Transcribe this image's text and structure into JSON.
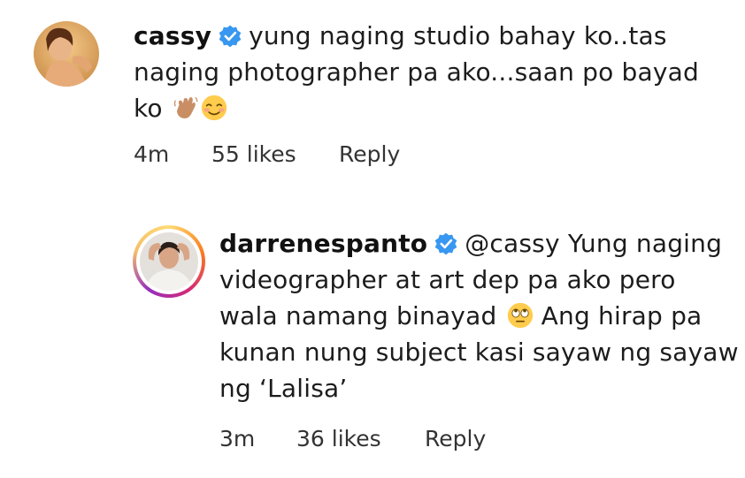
{
  "comments": [
    {
      "username": "cassy",
      "text": "yung naging studio bahay ko..tas naging photographer pa ako...saan po bayad ko",
      "emojis": [
        "waving-hand-medium-skin-emoji",
        "smiling-face-emoji"
      ],
      "time": "4m",
      "likes": "55 likes",
      "reply_label": "Reply"
    },
    {
      "username": "darrenespanto",
      "text_part1": "@cassy Yung naging videographer at art dep pa ako pero wala namang binayad",
      "emoji": "face-with-rolling-eyes-emoji",
      "text_part2": "Ang hirap pa kunan nung subject kasi sayaw ng sayaw ng ‘Lalisa’",
      "time": "3m",
      "likes": "36 likes",
      "reply_label": "Reply"
    }
  ],
  "colors": {
    "verified_blue": "#3897f0",
    "text": "#1c1c1c"
  }
}
